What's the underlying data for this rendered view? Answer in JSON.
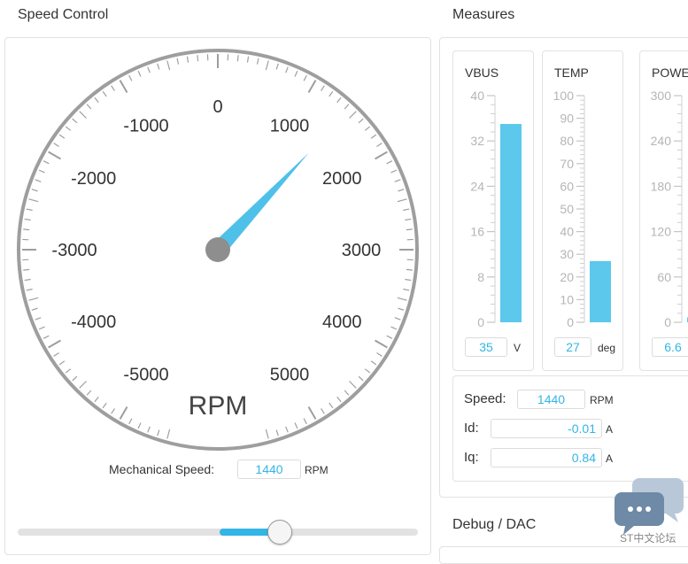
{
  "speed_control": {
    "title": "Speed Control",
    "gauge": {
      "unit_label": "RPM",
      "min": -6000,
      "max": 6000,
      "major_step": 1000,
      "minor_step": 100,
      "value": 1440,
      "tick_labels": [
        "-5000",
        "-4000",
        "-3000",
        "-2000",
        "-1000",
        "0",
        "1000",
        "2000",
        "3000",
        "4000",
        "5000"
      ],
      "needle_color": "#4fc1e9"
    },
    "mechanical_speed": {
      "label": "Mechanical Speed:",
      "value": "1440",
      "unit": "RPM"
    },
    "slider": {
      "fraction": 0.65,
      "fill_from": 0.5,
      "accent": "#33b5e5"
    }
  },
  "measures": {
    "title": "Measures",
    "meters": [
      {
        "title": "VBUS",
        "ticks": [
          "40",
          "32",
          "24",
          "16",
          "8",
          "0"
        ],
        "max": 40,
        "value": 35,
        "value_text": "35",
        "unit": "V"
      },
      {
        "title": "TEMP",
        "ticks": [
          "100",
          "90",
          "80",
          "70",
          "60",
          "50",
          "40",
          "30",
          "20",
          "10",
          "0"
        ],
        "max": 100,
        "value": 27,
        "value_text": "27",
        "unit": "deg"
      },
      {
        "title": "POWE",
        "ticks": [
          "300",
          "240",
          "180",
          "120",
          "60",
          "0"
        ],
        "max": 300,
        "value": 6.6,
        "value_text": "6.6",
        "unit": ""
      }
    ],
    "bar_color": "#5bc8ec",
    "speed": {
      "label": "Speed:",
      "value": "1440",
      "unit": "RPM"
    },
    "id": {
      "label": "Id:",
      "value": "-0.01",
      "unit": "A"
    },
    "iq": {
      "label": "Iq:",
      "value": "0.84",
      "unit": "A"
    }
  },
  "debug": {
    "title": "Debug / DAC"
  },
  "watermark": {
    "text": "ST中文论坛",
    "icon": "chat-bubbles-icon"
  }
}
